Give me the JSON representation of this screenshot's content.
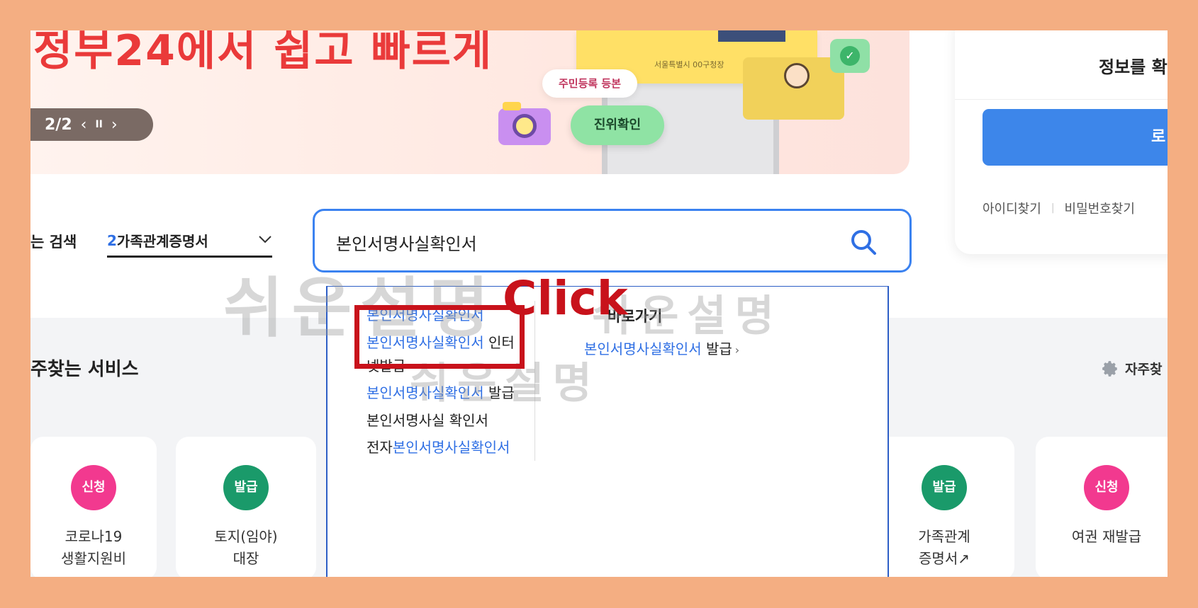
{
  "banner": {
    "headline": "정부24에서 쉽고 빠르게",
    "pager": {
      "current": "2/2",
      "prev": "‹",
      "pause": "II",
      "next": "›"
    },
    "card_text": "서울특별시 00구청장",
    "pill_resident": "주민등록 등본",
    "pill_verify": "진위확인"
  },
  "login": {
    "info_text": "정보를 확",
    "button_label": "로",
    "find_id": "아이디찾기",
    "find_pw": "비밀번호찾기"
  },
  "search": {
    "label": "는 검색",
    "category_num": "2",
    "category_text": "가족관계증명서",
    "query": "본인서명사실확인서"
  },
  "autocomplete": {
    "suggestions": [
      {
        "hl": "본인서명사실확인서",
        "rest": ""
      },
      {
        "hl": "본인서명사실확인서",
        "rest": " 인터"
      },
      {
        "hl": "",
        "rest": "넷발급"
      },
      {
        "hl": "본인서명사실확인서",
        "rest": " 발급"
      },
      {
        "hl": "",
        "rest": "본인서명사실 확인서"
      },
      {
        "pre": "전자",
        "hl": "본인서명사실확인서",
        "rest": ""
      }
    ],
    "quick_title": "바로가기",
    "quick_link_hl": "본인서명사실확인서",
    "quick_link_rest": " 발급",
    "quick_link_arrow": "›"
  },
  "services": {
    "title": "주찾는 서비스",
    "settings_label": "자주찾",
    "items": [
      {
        "badge": "신청",
        "type": "apply",
        "line1": "코로나19",
        "line2": "생활지원비"
      },
      {
        "badge": "발급",
        "type": "issue",
        "line1": "토지(임야)",
        "line2": "대장"
      },
      {
        "badge": "발급",
        "type": "issue",
        "line1": "가족관계",
        "line2": "증명서↗"
      },
      {
        "badge": "신청",
        "type": "apply",
        "line1": "여권 재발급",
        "line2": ""
      }
    ]
  },
  "overlay": {
    "click_text": "Click",
    "watermark": "쉬운설명"
  },
  "colors": {
    "frame": "#f4ae82",
    "accent_blue": "#3b82f0",
    "highlight_red": "#c8121b",
    "apply_pink": "#f2398f",
    "issue_green": "#1a9a6a"
  }
}
